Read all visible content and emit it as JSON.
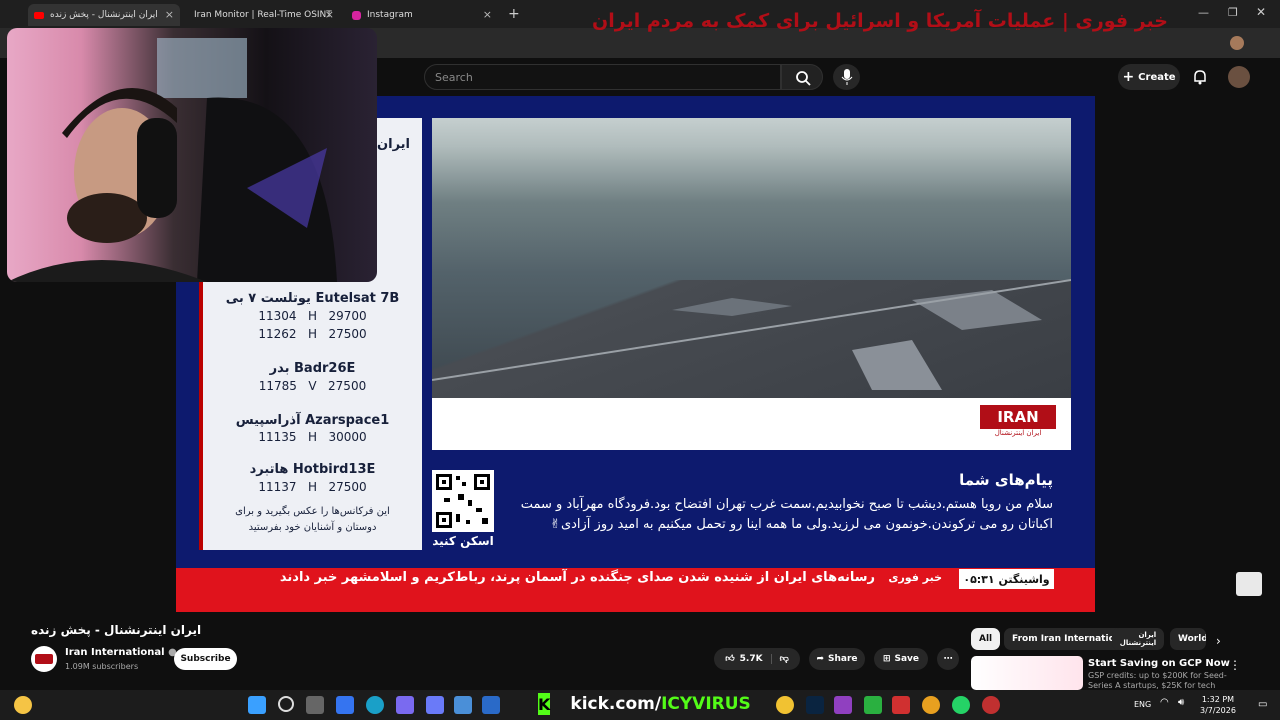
{
  "browser": {
    "tabs": [
      {
        "label": "ایران اینترنشنال - پخش زنده"
      },
      {
        "label": "Iran Monitor | Real-Time OSINT"
      },
      {
        "label": "Instagram"
      }
    ]
  },
  "youtube": {
    "search_placeholder": "Search",
    "create_label": "Create"
  },
  "video": {
    "freqs": [
      {
        "name": "یوتلست ۷ بی Eutelsat 7B",
        "l1": "11304   H   29700",
        "l2": "11262   H   27500"
      },
      {
        "name": "بدر Badr26E",
        "l1": "11785   V   27500",
        "l2": ""
      },
      {
        "name": "آذراسپیس Azarspace1",
        "l1": "11135   H   30000",
        "l2": ""
      },
      {
        "name": "هاتبرد Hotbird13E",
        "l1": "11137   H   27500",
        "l2": ""
      }
    ],
    "freq_note": "این فرکانس‌ها را عکس بگیرید و برای دوستان و آشنایان خود بفرستید",
    "panel_top": "ایران فرکا",
    "headline": "خبر فوری | عملیات آمریکا و اسرائیل برای کمک به مردم ایران",
    "logo_text": "IRAN",
    "logo_sub": "ایران اینترنشنال",
    "scan_label": "اسکن کنید",
    "messages_title": "پیام‌های شما",
    "messages_body": "سلام من رویا هستم.دیشب تا صبح نخوابیدیم.سمت غرب تهران افتضاح بود.فرودگاه مهرآباد و سمت اکباتان رو می ترکوندن.خونمون می لرزید.ولی ما همه اینا رو تحمل میکنیم به امید روز آزادی✌",
    "ticker_time": "واشینگتن ۰۵:۳۱",
    "ticker_tag": "خبر فوری",
    "ticker_text": "رسانه‌های ایران از شنیده شدن صدای جنگنده در آسمان پرند، رباط‌کریم و اسلامشهر خبر دادند"
  },
  "page": {
    "title": "ایران اینترنشنال - پخش زنده",
    "channel": "Iran International",
    "subscribers": "1.09M subscribers",
    "subscribe": "Subscribe",
    "likes": "5.7K",
    "share": "Share",
    "save": "Save"
  },
  "sidebar": {
    "chips": [
      "All",
      "From Iran International",
      "ایران اینترنشنال",
      "World"
    ],
    "suggestion_title": "Start Saving on GCP Now",
    "suggestion_sub": "GSP credits: up to $200K for Seed-Series A startups, $25K for tech"
  },
  "taskbar": {
    "kick_prefix": "kick.com/",
    "kick_name": "ICYVIRUS",
    "lang": "ENG",
    "time": "1:32 PM",
    "date": "3/7/2026"
  },
  "colors": {
    "accent_red": "#e0131c",
    "navy": "#0d1a6e",
    "kick_green": "#53fc18"
  }
}
